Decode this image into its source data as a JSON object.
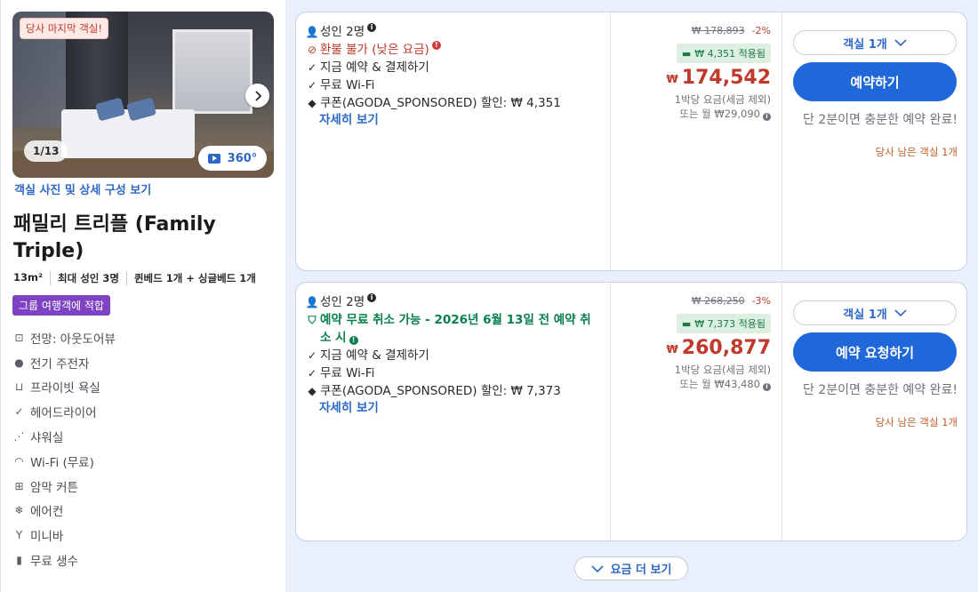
{
  "room": {
    "badge": "당사 마지막 객실!",
    "photo_counter": "1/13",
    "vr_label": "360°",
    "photo_link": "객실 사진 및 상세 구성 보기",
    "title": "패밀리 트리플 (Family Triple)",
    "meta": [
      "13m²",
      "최대 성인 3명",
      "퀸베드 1개 + 싱글베드 1개"
    ],
    "group_badge": "그룹 여행객에 적합",
    "features": [
      {
        "icon": "view-icon",
        "label": "전망: 아웃도어뷰"
      },
      {
        "icon": "check-circle-icon",
        "label": "전기 주전자"
      },
      {
        "icon": "bathtub-icon",
        "label": "프라이빗 욕실"
      },
      {
        "icon": "checkmark-icon",
        "label": "헤어드라이어"
      },
      {
        "icon": "shower-icon",
        "label": "샤워실"
      },
      {
        "icon": "wifi-icon",
        "label": "Wi-Fi (무료)"
      },
      {
        "icon": "curtain-icon",
        "label": "암막 커튼"
      },
      {
        "icon": "snowflake-icon",
        "label": "에어컨"
      },
      {
        "icon": "cocktail-icon",
        "label": "미니바"
      },
      {
        "icon": "water-bottle-icon",
        "label": "무료 생수"
      }
    ]
  },
  "offers": [
    {
      "guests": "성인 2명",
      "policy": "환불 불가 (낮은 요금)",
      "policy_cont": "",
      "pay": "지금 예약 & 결제하기",
      "wifi": "무료 Wi-Fi",
      "coupon": "쿠폰(AGODA_SPONSORED) 할인: ₩ 4,351",
      "details": "자세히 보기",
      "orig_price": "₩ 178,893",
      "discount": "-2%",
      "coupon_applied": "₩ 4,351 적용됨",
      "currency": "₩",
      "price": "174,542",
      "per_night": "1박당 요금(세금 제외)",
      "monthly": "또는 월 ₩29,090",
      "room_select": "객실 1개",
      "book_label": "예약하기",
      "quick": "단 2분이면 충분한 예약 완료!",
      "left": "당사 남은 객실 1개"
    },
    {
      "guests": "성인 2명",
      "policy": "예약 무료 취소 가능 - 2026년 6월 13일 전 예약 취",
      "policy_cont": "소 시",
      "pay": "지금 예약 & 결제하기",
      "wifi": "무료 Wi-Fi",
      "coupon": "쿠폰(AGODA_SPONSORED) 할인: ₩ 7,373",
      "details": "자세히 보기",
      "orig_price": "₩ 268,250",
      "discount": "-3%",
      "coupon_applied": "₩ 7,373 적용됨",
      "currency": "₩",
      "price": "260,877",
      "per_night": "1박당 요금(세금 제외)",
      "monthly": "또는 월 ₩43,480",
      "room_select": "객실 1개",
      "book_label": "예약 요청하기",
      "quick": "단 2분이면 충분한 예약 완료!",
      "left": "당사 남은 객실 1개"
    }
  ],
  "more_rates": "요금 더 보기",
  "colors": {
    "accent": "#2067d9",
    "price": "#c0392b",
    "green": "#08804d",
    "purple": "#7d43c3"
  }
}
